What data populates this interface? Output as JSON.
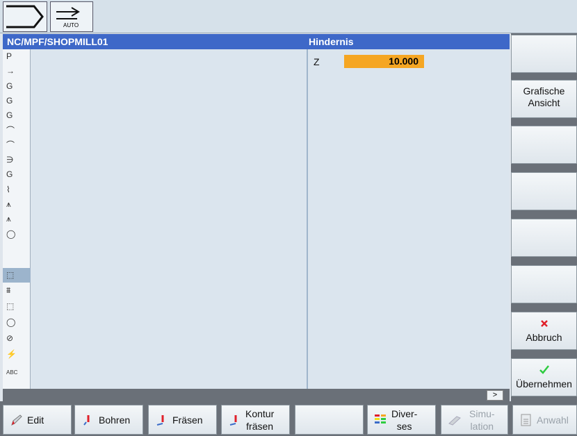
{
  "header": {
    "mode_label": "AUTO"
  },
  "title": {
    "path": "NC/MPF/SHOPMILL01",
    "dialog": "Hindernis"
  },
  "icon_column": [
    "P",
    "→",
    "G",
    "G",
    "G",
    "⌒",
    "⌒",
    "∋",
    "G",
    "⌇",
    "⩚",
    "⩚",
    "◯",
    "⬚",
    "⩩",
    "⬚",
    "◯",
    "⊘",
    "⚡",
    "ABC"
  ],
  "params": {
    "z_label": "Z",
    "z_value": "10.000"
  },
  "status": {
    "more": ">"
  },
  "softkeys_vertical": [
    {
      "label": ""
    },
    {
      "label": "Grafische Ansicht"
    },
    {
      "label": ""
    },
    {
      "label": ""
    },
    {
      "label": ""
    },
    {
      "label": ""
    },
    {
      "label": "Abbruch",
      "icon": "cancel-x-icon"
    },
    {
      "label": "Übernehmen",
      "icon": "accept-check-icon"
    }
  ],
  "softkeys_horizontal": [
    {
      "label": "Edit"
    },
    {
      "label": "Bohren"
    },
    {
      "label": "Fräsen"
    },
    {
      "label1": "Kontur",
      "label2": "fräsen"
    },
    {
      "label": ""
    },
    {
      "label1": "Diver-",
      "label2": "ses"
    },
    {
      "label1": "Simu-",
      "label2": "lation"
    },
    {
      "label": "Anwahl"
    }
  ],
  "colors": {
    "title_bar": "#3e68c8",
    "param_highlight": "#f5a623",
    "selected_row": "#9cb4cc"
  }
}
